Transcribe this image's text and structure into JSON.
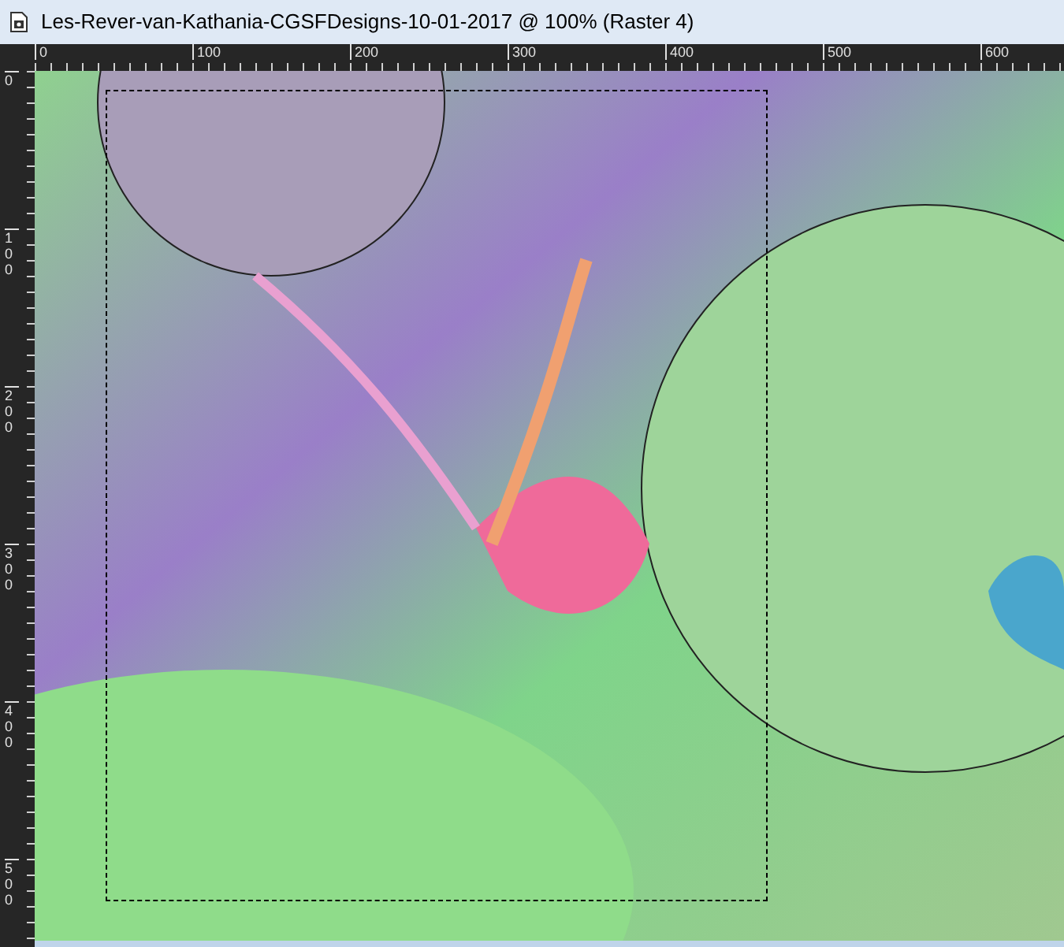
{
  "window": {
    "title": "Les-Rever-van-Kathania-CGSFDesigns-10-01-2017 @ 100% (Raster 4)"
  },
  "rulers": {
    "horizontal": [
      "0",
      "100",
      "200",
      "300",
      "400",
      "500",
      "600"
    ],
    "vertical": [
      "0",
      "100",
      "200",
      "300",
      "400",
      "500"
    ]
  }
}
